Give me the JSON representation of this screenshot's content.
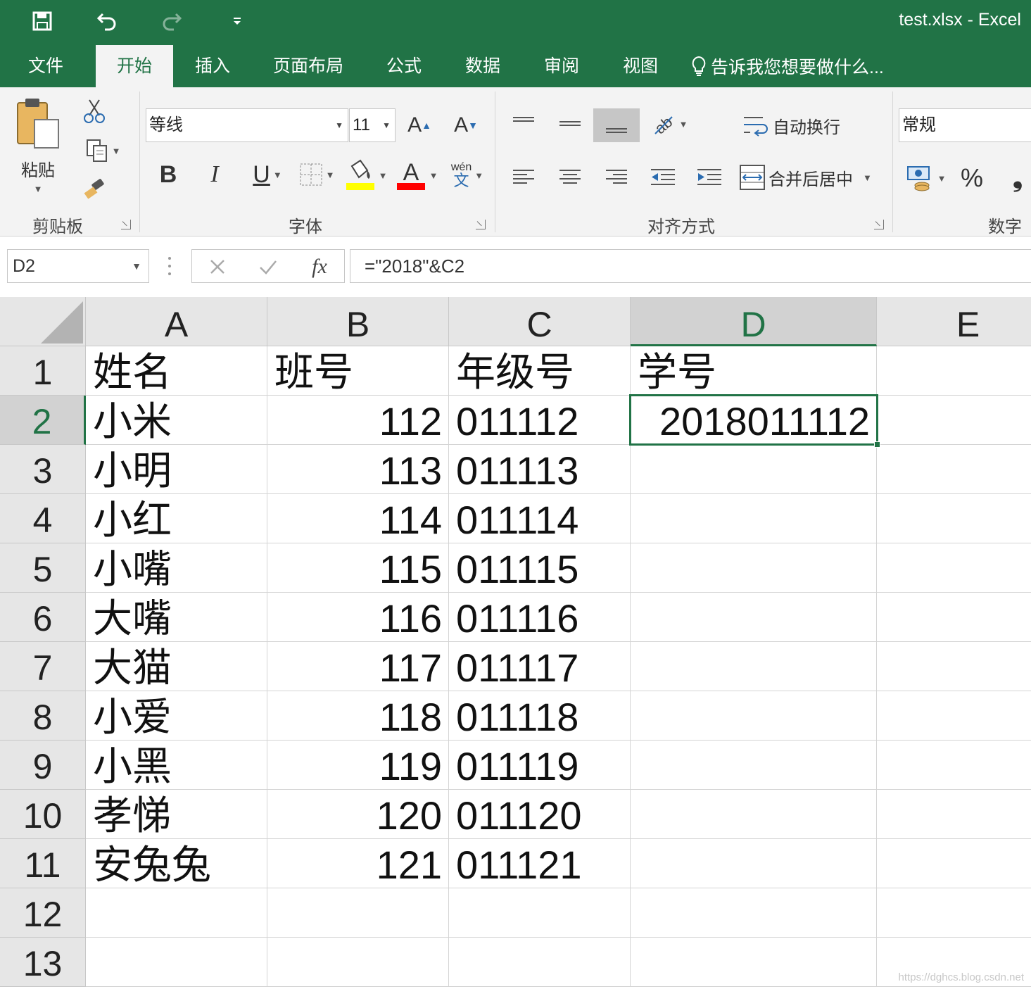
{
  "window": {
    "title": "test.xlsx - Excel",
    "accent_color": "#217346",
    "quick_access": [
      "save-icon",
      "undo-icon",
      "redo-icon",
      "customize-quick-access-icon"
    ]
  },
  "ribbon": {
    "tabs": [
      {
        "label": "文件",
        "active": false
      },
      {
        "label": "开始",
        "active": true
      },
      {
        "label": "插入",
        "active": false
      },
      {
        "label": "页面布局",
        "active": false
      },
      {
        "label": "公式",
        "active": false
      },
      {
        "label": "数据",
        "active": false
      },
      {
        "label": "审阅",
        "active": false
      },
      {
        "label": "视图",
        "active": false
      }
    ],
    "tell_me": "告诉我您想要做什么...",
    "clipboard": {
      "label": "剪贴板",
      "paste_label": "粘贴"
    },
    "font": {
      "label": "字体",
      "font_name": "等线",
      "font_size": "11",
      "phonetic_label": "wén",
      "phonetic_char": "文",
      "highlight_color": "#ffff00",
      "font_color": "#ff0000"
    },
    "alignment": {
      "label": "对齐方式",
      "wrap_text": "自动换行",
      "merge_center": "合并后居中"
    },
    "number": {
      "label": "数字",
      "format": "常规",
      "percent": "%",
      "comma": "❟"
    }
  },
  "formula_bar": {
    "name_box": "D2",
    "fx": "fx",
    "formula": "=\"2018\"&C2"
  },
  "sheet": {
    "columns": [
      "A",
      "B",
      "C",
      "D",
      "E"
    ],
    "rows": [
      "1",
      "2",
      "3",
      "4",
      "5",
      "6",
      "7",
      "8",
      "9",
      "10",
      "11",
      "12",
      "13"
    ],
    "selected_cell": "D2",
    "data": [
      [
        "姓名",
        "班号",
        "年级号",
        "学号",
        ""
      ],
      [
        "小米",
        "112",
        "011112",
        "2018011112",
        ""
      ],
      [
        "小明",
        "113",
        "011113",
        "",
        ""
      ],
      [
        "小红",
        "114",
        "011114",
        "",
        ""
      ],
      [
        "小嘴",
        "115",
        "011115",
        "",
        ""
      ],
      [
        "大嘴",
        "116",
        "011116",
        "",
        ""
      ],
      [
        "大猫",
        "117",
        "011117",
        "",
        ""
      ],
      [
        "小爱",
        "118",
        "011118",
        "",
        ""
      ],
      [
        "小黑",
        "119",
        "011119",
        "",
        ""
      ],
      [
        "孝悌",
        "120",
        "011120",
        "",
        ""
      ],
      [
        "安兔兔",
        "121",
        "011121",
        "",
        ""
      ],
      [
        "",
        "",
        "",
        "",
        ""
      ],
      [
        "",
        "",
        "",
        "",
        ""
      ]
    ]
  },
  "watermark": "https://dghcs.blog.csdn.net"
}
